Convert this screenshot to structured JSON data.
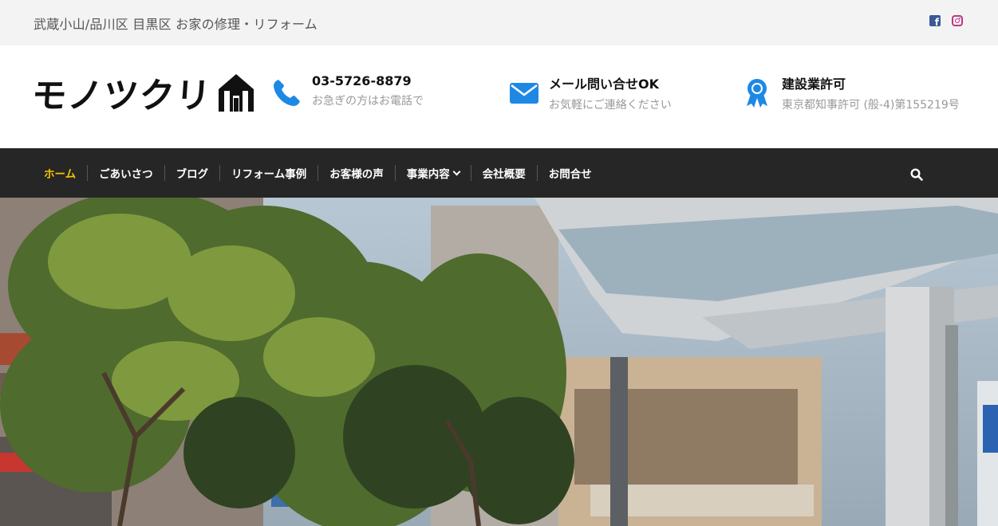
{
  "topbar": {
    "tagline": "武蔵小山/品川区 目黒区 お家の修理・リフォーム",
    "social": [
      "facebook-icon",
      "instagram-icon"
    ]
  },
  "header": {
    "logo_text": "モノツクリ",
    "phone": {
      "title": "03-5726-8879",
      "sub": "お急ぎの方はお電話で",
      "icon": "phone-icon"
    },
    "mail": {
      "title": "メール問い合せOK",
      "sub": "お気軽にご連絡ください",
      "icon": "envelope-icon"
    },
    "license": {
      "title": "建設業許可",
      "sub": "東京都知事許可 (般-4)第155219号",
      "icon": "award-ribbon-icon"
    }
  },
  "nav": {
    "items": [
      {
        "label": "ホーム",
        "active": true
      },
      {
        "label": "ごあいさつ"
      },
      {
        "label": "ブログ"
      },
      {
        "label": "リフォーム事例"
      },
      {
        "label": "お客様の声"
      },
      {
        "label": "事業内容",
        "dropdown": true
      },
      {
        "label": "会社概要"
      },
      {
        "label": "お問合せ"
      }
    ]
  },
  "colors": {
    "accent_blue": "#1e88e5",
    "nav_bg": "#262626",
    "nav_active": "#f5c400",
    "topbar_bg": "#f3f3f3"
  }
}
